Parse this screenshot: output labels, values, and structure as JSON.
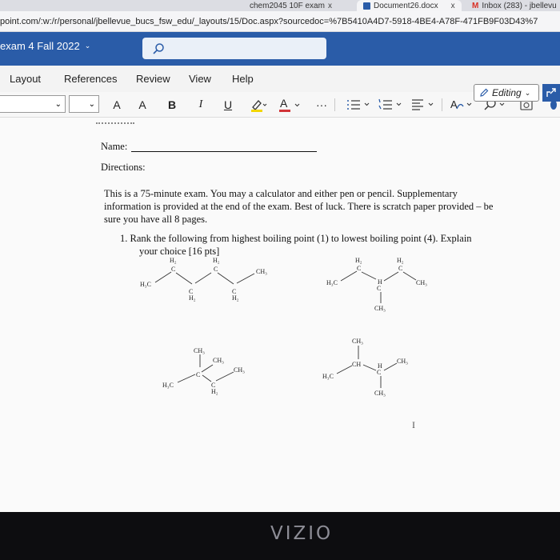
{
  "browser": {
    "tabs": [
      {
        "label": "chem2045 10F exam",
        "close": "x"
      },
      {
        "label": "Document26.docx",
        "close": "x"
      },
      {
        "label": "Inbox (283) - jbellevu"
      }
    ],
    "url": "point.com/:w:/r/personal/jbellevue_bucs_fsw_edu/_layouts/15/Doc.aspx?sourcedoc=%7B5410A4D7-5918-4BE4-A78F-471FB9F03D43%7"
  },
  "title_bar": {
    "doc_title": "exam 4 Fall 2022",
    "search_icon": "search-icon"
  },
  "menu": {
    "items": [
      "Layout",
      "References",
      "Review",
      "View",
      "Help"
    ]
  },
  "toolbar": {
    "grow_font": "A",
    "shrink_font": "A",
    "bold": "B",
    "italic": "I",
    "underline": "U",
    "more": "···",
    "editing_label": "Editing"
  },
  "document": {
    "name_label": "Name:",
    "directions_label": "Directions:",
    "directions_text": [
      "This is a 75-minute exam. You may a calculator and either pen or pencil. Supplementary",
      "information is provided at the end of the exam. Best of luck. There is scratch paper provided – be",
      "sure you have all 8 pages."
    ],
    "question_1": [
      "1.  Rank the following from highest boiling point (1) to lowest boiling point (4). Explain",
      "your choice [16 pts]"
    ],
    "structure_labels": {
      "h3c": "H₃C",
      "h2": "H₂",
      "c": "C",
      "ch3": "CH₃",
      "ch": "CH",
      "h": "H"
    }
  },
  "tv": {
    "brand": "VIZIO"
  },
  "colors": {
    "ribbon_blue": "#2a5ca8",
    "highlight_yellow": "#f2d600",
    "font_red": "#d13438",
    "page": "#fafafa"
  }
}
